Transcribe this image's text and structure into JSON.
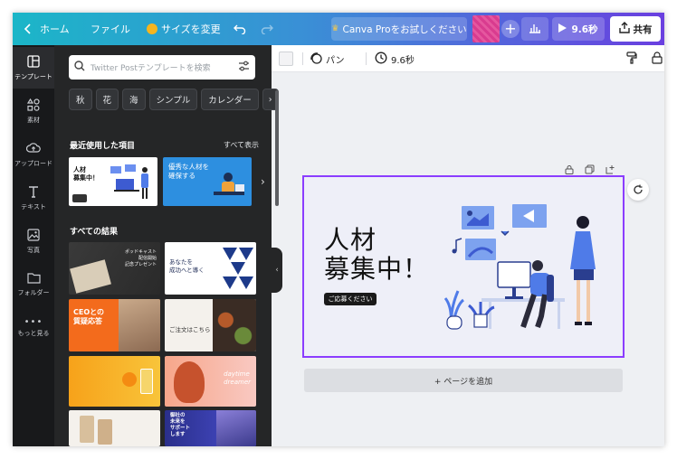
{
  "topbar": {
    "home_label": "ホーム",
    "file_label": "ファイル",
    "resize_label": "サイズを変更",
    "pro_label": "Canva Proをお試しください",
    "play_label": "9.6秒",
    "share_label": "共有"
  },
  "rail": {
    "items": [
      {
        "label": "テンプレート",
        "icon": "template-icon"
      },
      {
        "label": "素材",
        "icon": "elements-icon"
      },
      {
        "label": "アップロード",
        "icon": "upload-icon"
      },
      {
        "label": "テキスト",
        "icon": "text-icon"
      },
      {
        "label": "写真",
        "icon": "photo-icon"
      },
      {
        "label": "フォルダー",
        "icon": "folder-icon"
      },
      {
        "label": "もっと見る",
        "icon": "more-icon"
      }
    ]
  },
  "panel": {
    "search_placeholder": "Twitter Postテンプレートを検索",
    "chips": [
      "秋",
      "花",
      "海",
      "シンプル",
      "カレンダー"
    ],
    "recent_title": "最近使用した項目",
    "see_all": "すべて表示",
    "results_title": "すべての結果",
    "thumbs": {
      "recent1": "人材\n募集中！",
      "recent2": "優秀な人材を\n確保する",
      "t_podcast": "ポッドキャスト\n配信開始\n記念プレゼント",
      "t_anata": "あなたを\n成功へと導く",
      "t_ceo": "CEOとの\n質疑応答",
      "t_order": "ご注文はこちら",
      "t_daytime": "daytime\ndreamer",
      "t_support": "御社の\n未来を\nサポート\nします"
    }
  },
  "editor": {
    "animate_label": "パン",
    "duration_label": "9.6秒",
    "headline_line1": "人材",
    "headline_line2": "募集中！",
    "cta_label": "ご応募ください",
    "add_page_label": "+ ページを追加"
  },
  "colors": {
    "accent": "#8b3dff",
    "panel_bg": "#252627",
    "rail_bg": "#18191b",
    "illustration_blue": "#4f7be8"
  }
}
